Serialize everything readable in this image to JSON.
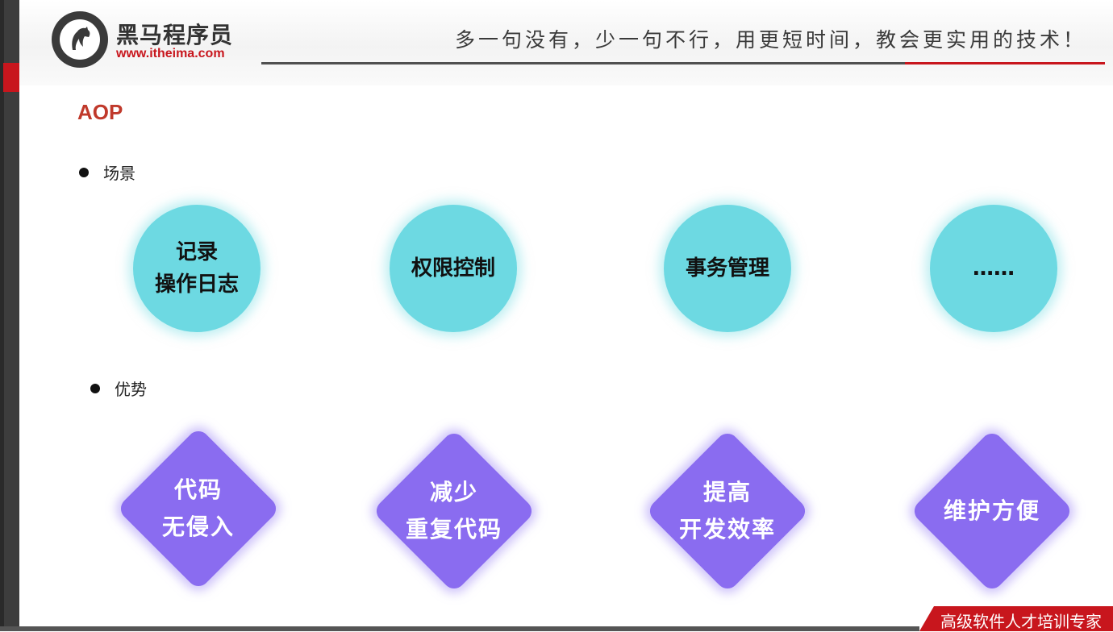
{
  "header": {
    "brand_cn": "黑马程序员",
    "brand_url": "www.itheima.com",
    "slogan": "多一句没有，少一句不行，用更短时间，教会更实用的技术！"
  },
  "title": "AOP",
  "scenarios": {
    "label": "场景",
    "items": [
      "记录\n操作日志",
      "权限控制",
      "事务管理",
      "……"
    ]
  },
  "advantages": {
    "label": "优势",
    "items": [
      "代码\n无侵入",
      "减少\n重复代码",
      "提高\n开发效率",
      "维护方便"
    ]
  },
  "footer": {
    "tag": "高级软件人才培训专家"
  },
  "colors": {
    "accent_red": "#c8161d",
    "circle_cyan": "#6dd9e2",
    "diamond_purple": "#8a6cf0"
  }
}
